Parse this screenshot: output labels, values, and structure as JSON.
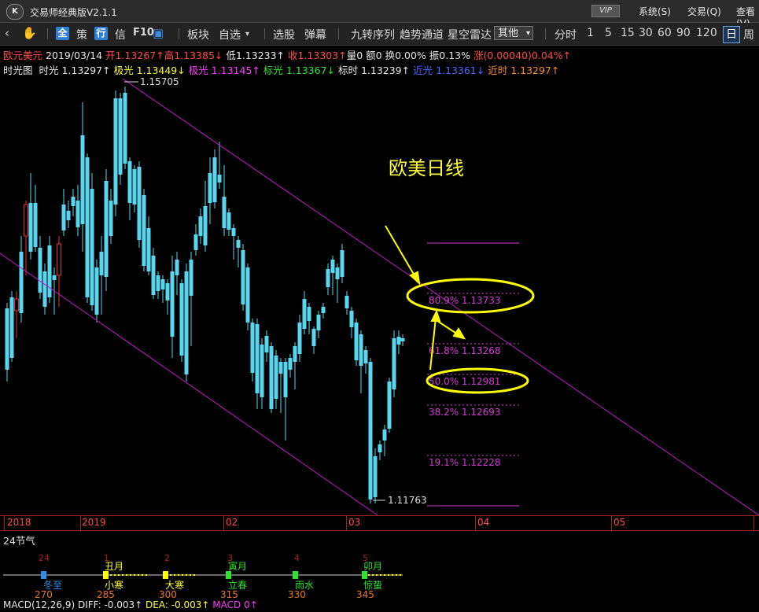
{
  "titlebar": {
    "logo": "K",
    "title": "交易师经典版V2.1.1",
    "vip": "VIP",
    "menus": [
      "系统(S)",
      "交易(Q)",
      "查看(V)"
    ]
  },
  "toolbar": {
    "icons": [
      "back-icon",
      "hand-icon"
    ],
    "quan": "全",
    "ce": "策",
    "hang": "行",
    "xin": "信",
    "f10": "F10",
    "items": [
      "板块",
      "自选",
      "选股",
      "弹幕",
      "九转序列",
      "趋势通道",
      "星空雷达"
    ],
    "other": "其他",
    "periods": [
      "分时",
      "1",
      "5",
      "15",
      "30",
      "60",
      "90",
      "120",
      "日",
      "周"
    ]
  },
  "info1": {
    "name": "欧元美元",
    "date": "2019/03/14",
    "open": "开1.13267↑",
    "high": "高1.13385↓",
    "low": "低1.13233↑",
    "close": "收1.13303↑",
    "vol": "量0",
    "amt": "额0",
    "turn": "换0.00%",
    "amp": "振0.13%",
    "chg": "涨(0.00040)0.04%↑"
  },
  "info2": {
    "label": "时光图",
    "shiguang": "时光 1.13297↑",
    "jiguang1": "极光 1.13449↓",
    "jiguang2": "极光 1.13145↑",
    "biaoguang": "标光 1.13367↓",
    "biaoshi": "标时 1.13239↑",
    "jinguang": "近光 1.13361↓",
    "jinshi": "近时 1.13297↑"
  },
  "chart": {
    "annotation": "欧美日线",
    "high_label": "1.15705",
    "low_label": "1.11763",
    "fib_labels": [
      "80.9% 1.13733",
      "61.8% 1.13268",
      "50.0% 1.12981",
      "38.2% 1.12693",
      "19.1% 1.12228"
    ]
  },
  "colors": {
    "up": "#e83232",
    "down": "#5bd6ee",
    "channel": "#c218c8",
    "fib": "#d83ad8",
    "highlight": "#ffff00"
  },
  "xaxis": {
    "labels": [
      "2018",
      "2019",
      "02",
      "03",
      "04",
      "05"
    ]
  },
  "solar": {
    "title": "24节气",
    "terms": [
      {
        "top": "24",
        "month": "",
        "name": "冬至",
        "deg": "270"
      },
      {
        "top": "1",
        "month": "丑月",
        "name": "小寒",
        "deg": "285"
      },
      {
        "top": "2",
        "month": "",
        "name": "大寒",
        "deg": "300"
      },
      {
        "top": "3",
        "month": "寅月",
        "name": "立春",
        "deg": "315"
      },
      {
        "top": "4",
        "month": "",
        "name": "雨水",
        "deg": "330"
      },
      {
        "top": "5",
        "month": "卯月",
        "name": "惊蛰",
        "deg": "345"
      }
    ]
  },
  "macd": {
    "name": "MACD(12,26,9)",
    "diff": "DIFF: -0.003↑",
    "dea": "DEA: -0.003↑",
    "macd": "MACD 0↑"
  }
}
